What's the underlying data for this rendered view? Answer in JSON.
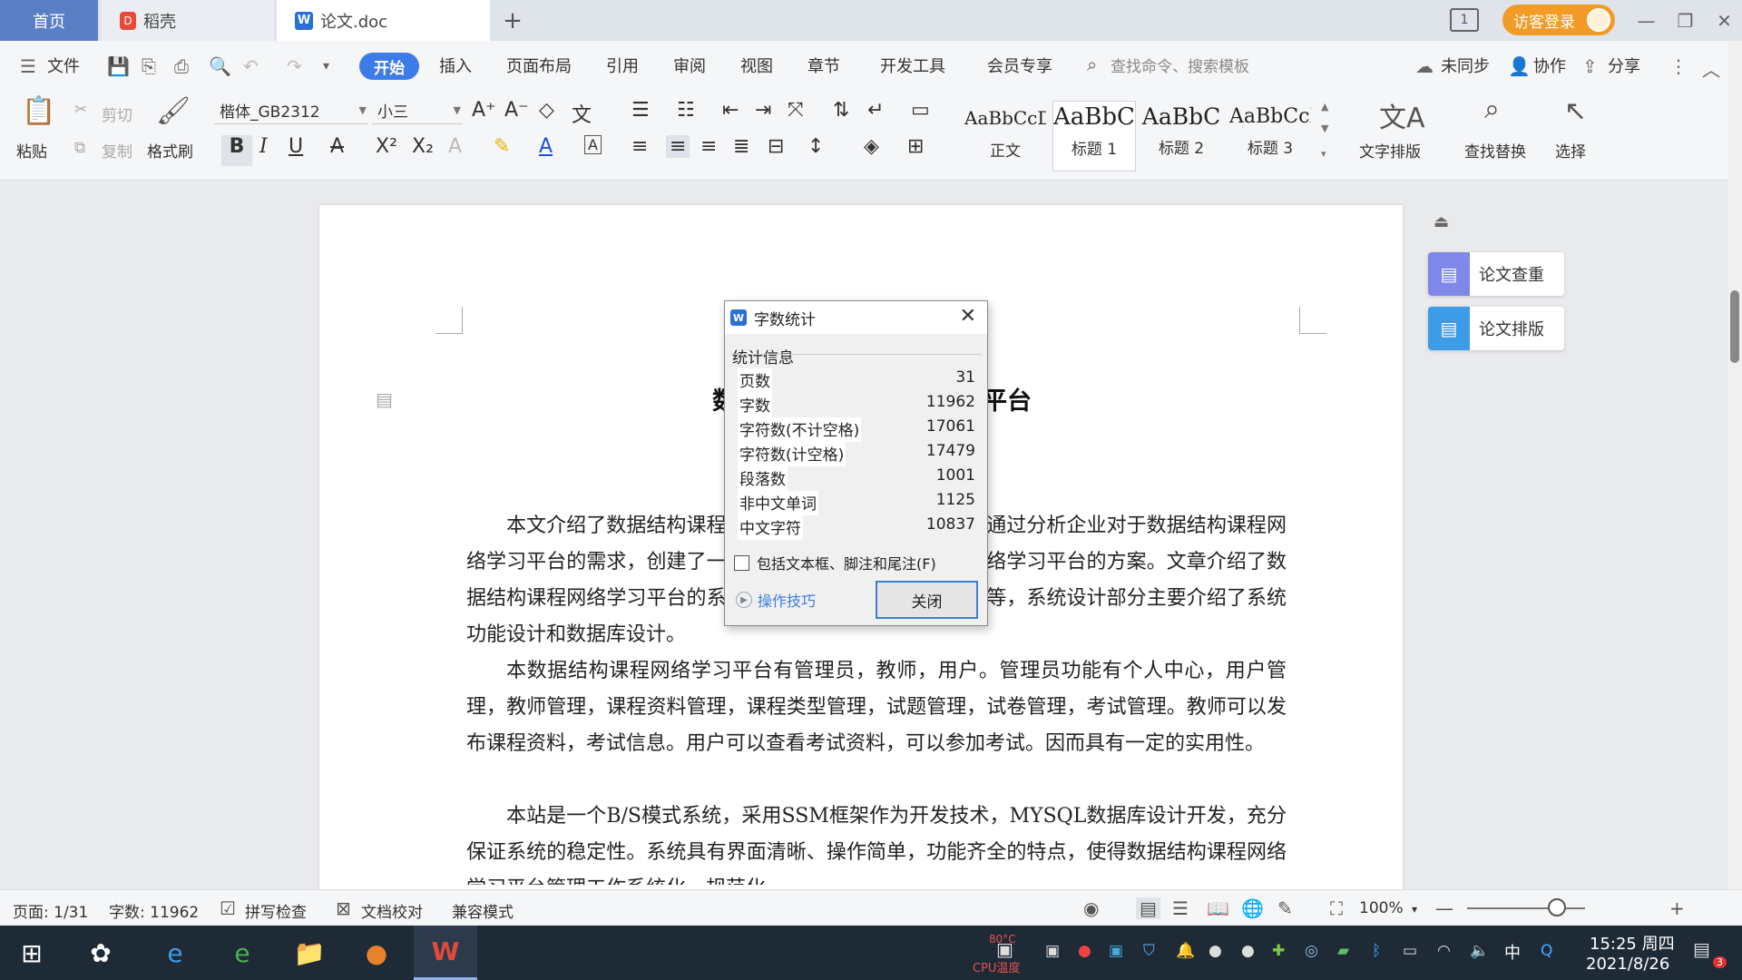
{
  "tabs": {
    "home": "首页",
    "daoke": "稻壳",
    "doc": "论文.doc"
  },
  "titlebar": {
    "guest_login": "访客登录"
  },
  "menu": {
    "file": "文件",
    "start": "开始",
    "insert": "插入",
    "page_layout": "页面布局",
    "reference": "引用",
    "review": "审阅",
    "view": "视图",
    "chapter": "章节",
    "dev_tools": "开发工具",
    "member": "会员专享",
    "search_placeholder": "查找命令、搜索模板",
    "unsynced": "未同步",
    "collaborate": "协作",
    "share": "分享"
  },
  "ribbon": {
    "paste": "粘贴",
    "cut": "剪切",
    "copy": "复制",
    "format_painter": "格式刷",
    "font_name": "楷体_GB2312",
    "font_size": "小三",
    "styles": [
      {
        "preview": "AaBbCcDd",
        "name": "正文"
      },
      {
        "preview": "AaBbC",
        "name": "标题 1"
      },
      {
        "preview": "AaBbC",
        "name": "标题 2"
      },
      {
        "preview": "AaBbCcI",
        "name": "标题 3"
      }
    ],
    "text_layout": "文字排版",
    "find_replace": "查找替换",
    "select": "选择"
  },
  "document": {
    "title_start": "数",
    "title_end": "平台",
    "paragraphs": [
      "本文介绍了数据结构课程网络学习平台的开发全过程。通过分析企业对于数据结构课程网络学习平台的需求，创建了一个计算机管理数据结构课程网络学习平台的方案。文章介绍了数据结构课程网络学习平台的系统分析部分，包括可行性分析等，系统设计部分主要介绍了系统功能设计和数据库设计。",
      "本数据结构课程网络学习平台有管理员，教师，用户。管理员功能有个人中心，用户管理，教师管理，课程资料管理，课程类型管理，试题管理，试卷管理，考试管理。教师可以发布课程资料，考试信息。用户可以查看考试资料，可以参加考试。因而具有一定的实用性。",
      "本站是一个B/S模式系统，采用SSM框架作为开发技术，MYSQL数据库设计开发，充分保证系统的稳定性。系统具有界面清晰、操作简单，功能齐全的特点，使得数据结构课程网络学习平台管理工作系统化、规范化。"
    ]
  },
  "side_panel": {
    "check": "论文查重",
    "format": "论文排版"
  },
  "dialog": {
    "title": "字数统计",
    "group_label": "统计信息",
    "stats": [
      {
        "label": "页数",
        "value": "31"
      },
      {
        "label": "字数",
        "value": "11962"
      },
      {
        "label": "字符数(不计空格)",
        "value": "17061"
      },
      {
        "label": "字符数(计空格)",
        "value": "17479"
      },
      {
        "label": "段落数",
        "value": "1001"
      },
      {
        "label": "非中文单词",
        "value": "1125"
      },
      {
        "label": "中文字符",
        "value": "10837"
      }
    ],
    "include_checkbox": "包括文本框、脚注和尾注(F)",
    "tips": "操作技巧",
    "close": "关闭"
  },
  "status": {
    "page": "页面: 1/31",
    "words": "字数: 11962",
    "spell_check": "拼写检查",
    "doc_proof": "文档校对",
    "compat_mode": "兼容模式",
    "zoom": "100%"
  },
  "taskbar": {
    "cpu_temp": "80°C",
    "cpu_label": "CPU温度",
    "input_method": "中",
    "time": "15:25 周四",
    "date": "2021/8/26",
    "notif_count": "3"
  },
  "colors": {
    "accent": "#3d7ce8",
    "home_tab": "#5b7fc4",
    "guest": "#f39b27",
    "side_check": "#7f87e8",
    "side_format": "#3d9be8"
  }
}
